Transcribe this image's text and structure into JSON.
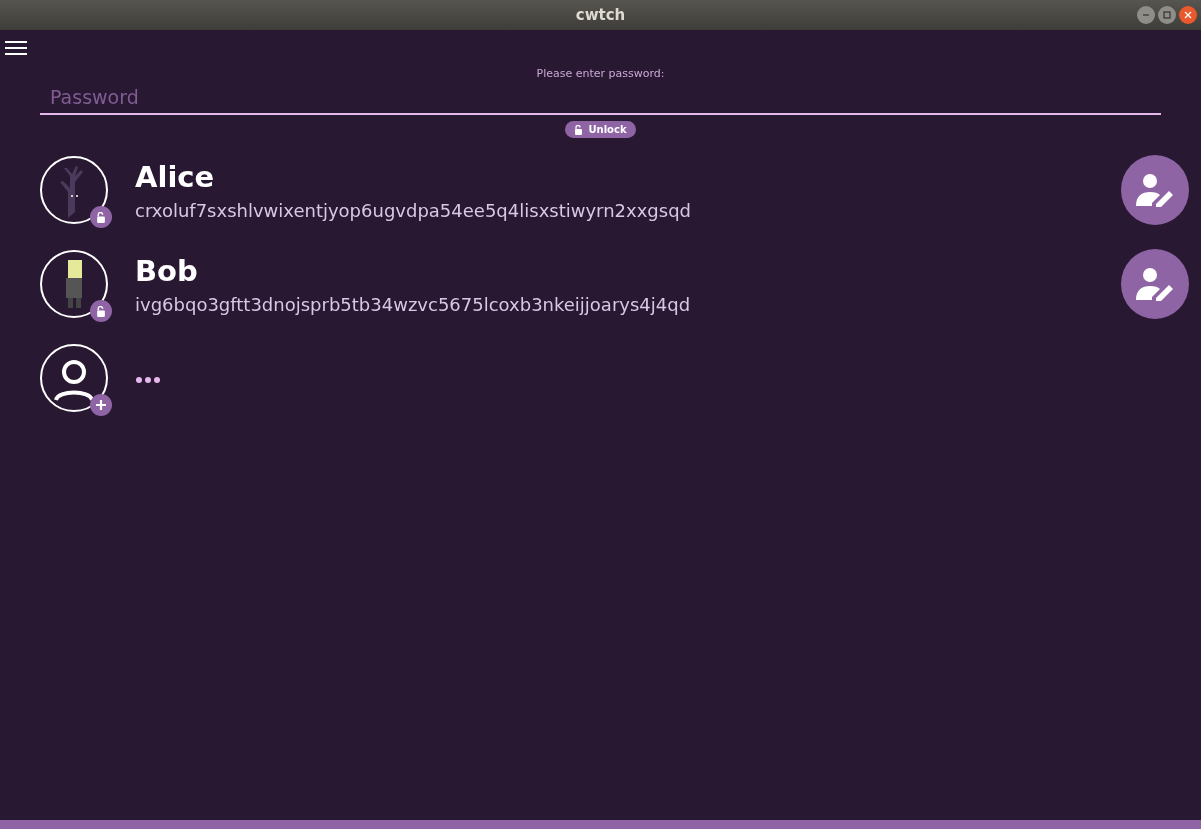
{
  "window": {
    "title": "cwtch"
  },
  "prompt": "Please enter password:",
  "password": {
    "placeholder": "Password"
  },
  "unlock_button": {
    "label": "Unlock"
  },
  "profiles": [
    {
      "kind": "tree",
      "name": "Alice",
      "address": "crxoluf7sxshlvwixentjyop6ugvdpa54ee5q4lisxstiwyrn2xxgsqd"
    },
    {
      "kind": "character",
      "name": "Bob",
      "address": "ivg6bqo3gftt3dnojsprb5tb34wzvc5675lcoxb3nkeijjoarys4j4qd"
    },
    {
      "kind": "add"
    }
  ]
}
